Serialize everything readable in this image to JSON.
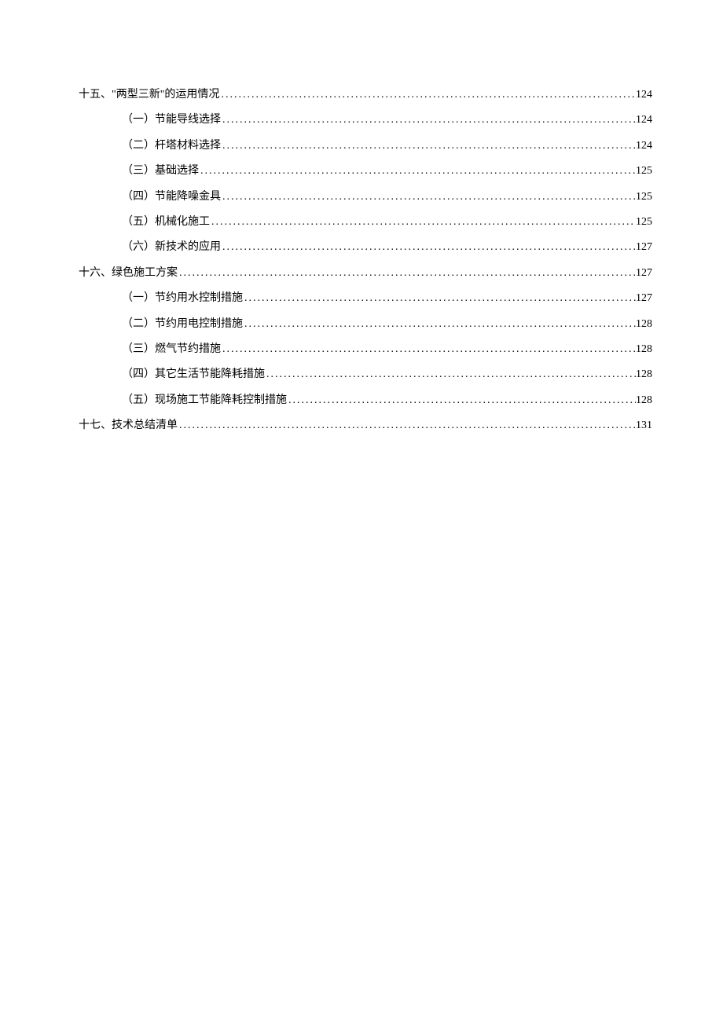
{
  "toc": [
    {
      "level": 1,
      "label": "十五、\"两型三新\"的运用情况",
      "page": "124"
    },
    {
      "level": 2,
      "label": "（一）节能导线选择",
      "page": "124"
    },
    {
      "level": 2,
      "label": "（二）杆塔材料选择",
      "page": "124"
    },
    {
      "level": 2,
      "label": "（三）基础选择",
      "page": "125"
    },
    {
      "level": 2,
      "label": "（四）节能降噪金具",
      "page": "125"
    },
    {
      "level": 2,
      "label": "（五）机械化施工",
      "page": "125"
    },
    {
      "level": 2,
      "label": "（六）新技术的应用",
      "page": "127"
    },
    {
      "level": 1,
      "label": "十六、绿色施工方案",
      "page": "127"
    },
    {
      "level": 2,
      "label": "（一）节约用水控制措施",
      "page": "127"
    },
    {
      "level": 2,
      "label": "（二）节约用电控制措施",
      "page": "128"
    },
    {
      "level": 2,
      "label": "（三）燃气节约措施",
      "page": "128"
    },
    {
      "level": 2,
      "label": "（四）其它生活节能降耗措施",
      "page": "128"
    },
    {
      "level": 2,
      "label": "（五）现场施工节能降耗控制措施",
      "page": "128"
    },
    {
      "level": 1,
      "label": "十七、技术总结清单",
      "page": "131"
    }
  ]
}
